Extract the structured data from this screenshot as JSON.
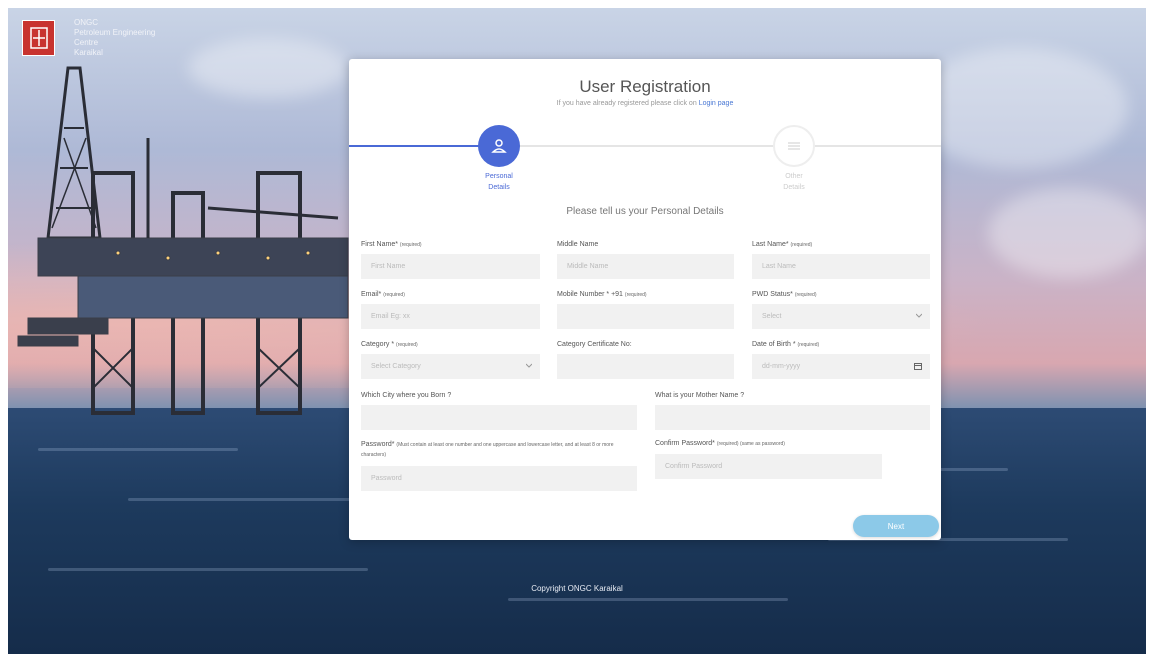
{
  "brand": {
    "logo_text": "ONGC",
    "lines": [
      "ONGC",
      "Petroleum Engineering",
      "Centre",
      "Karaikal"
    ]
  },
  "form": {
    "title": "User Registration",
    "subtitle_text": "If you have already registered please click on",
    "subtitle_link": "Login page",
    "steps": [
      {
        "label_line1": "Personal",
        "label_line2": "Details",
        "active": true,
        "icon": "user-icon"
      },
      {
        "label_line1": "Other",
        "label_line2": "Details",
        "active": false,
        "icon": "list-icon"
      }
    ],
    "section_title": "Please tell us your Personal Details",
    "fields": {
      "first_name": {
        "label": "First Name*",
        "req": "(required)",
        "placeholder": "First Name"
      },
      "middle_name": {
        "label": "Middle Name",
        "req": "",
        "placeholder": "Middle Name"
      },
      "last_name": {
        "label": "Last Name*",
        "req": "(required)",
        "placeholder": "Last Name"
      },
      "email": {
        "label": "Email*",
        "req": "(required)",
        "placeholder": "Email Eg: xx"
      },
      "mobile": {
        "label": "Mobile Number * +91",
        "req": "(required)",
        "placeholder": ""
      },
      "pwd_status": {
        "label": "PWD Status*",
        "req": "(required)",
        "value": "Select"
      },
      "category": {
        "label": "Category *",
        "req": "(required)",
        "value": "Select Category"
      },
      "category_cert": {
        "label": "Category Certificate No:",
        "req": "",
        "placeholder": ""
      },
      "dob": {
        "label": "Date of Birth *",
        "req": "(required)",
        "value": "dd-mm-yyyy"
      },
      "birth_city": {
        "label": "Which City where you Born ?",
        "req": "",
        "placeholder": ""
      },
      "mother_name": {
        "label": "What is your Mother Name ?",
        "req": "",
        "placeholder": ""
      },
      "password": {
        "label": "Password*",
        "req": "(Must contain at least one number and one uppercase and lowercase letter, and at least 8 or more characters)",
        "placeholder": "Password"
      },
      "confirm_password": {
        "label": "Confirm Password*",
        "req": "(required) (same as password)",
        "placeholder": "Confirm Password"
      }
    },
    "next_label": "Next"
  },
  "footer": {
    "text": "Copyright ONGC Karaikal"
  },
  "colors": {
    "accent": "#4a69d6",
    "next_button": "#8cc9e8",
    "brand_red": "#c8332f"
  }
}
